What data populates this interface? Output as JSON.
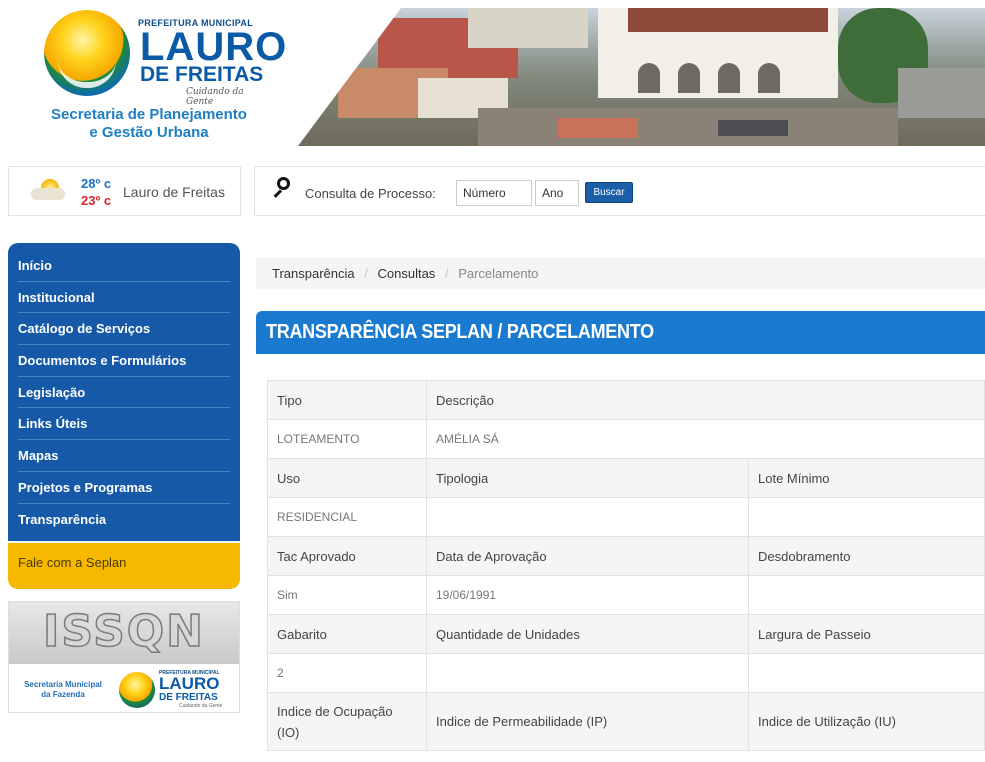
{
  "header": {
    "logo": {
      "prefeitura": "PREFEITURA MUNICIPAL",
      "name_line1": "LAURO",
      "name_line2": "DE FREITAS",
      "tagline": "Cuidando da Gente"
    },
    "secretaria_line1": "Secretaria de Planejamento",
    "secretaria_line2": "e Gestão Urbana"
  },
  "weather": {
    "icon": "sun-cloud-icon",
    "max": "28º c",
    "min": "23º c",
    "city": "Lauro de Freitas"
  },
  "search": {
    "label": "Consulta de Processo:",
    "numero_value": "Número",
    "ano_value": "Ano",
    "button": "Buscar"
  },
  "menu": {
    "items": [
      {
        "label": "Início"
      },
      {
        "label": "Institucional"
      },
      {
        "label": "Catálogo de Serviços"
      },
      {
        "label": "Documentos e Formulários"
      },
      {
        "label": "Legislação"
      },
      {
        "label": "Links Úteis"
      },
      {
        "label": "Mapas"
      },
      {
        "label": "Projetos e Programas"
      },
      {
        "label": "Transparência"
      }
    ],
    "fale": "Fale com a Seplan"
  },
  "issqn": {
    "title": "ISSQN",
    "secretaria": "Secretaria Municipal da Fazenda",
    "logo_small": "PREFEITURA MUNICIPAL",
    "logo_l1": "LAURO",
    "logo_l2": "DE FREITAS",
    "logo_tag": "Cuidando da Gente"
  },
  "breadcrumb": {
    "items": [
      "Transparência",
      "Consultas"
    ],
    "current": "Parcelamento",
    "separator": "/"
  },
  "page": {
    "title": "TRANSPARÊNCIA SEPLAN / PARCELAMENTO"
  },
  "table": {
    "rows": [
      {
        "type": "hdr",
        "cells": [
          "Tipo",
          "Descrição"
        ]
      },
      {
        "type": "val",
        "cells": [
          "LOTEAMENTO",
          "AMÉLIA SÁ"
        ]
      },
      {
        "type": "hdr",
        "cells": [
          "Uso",
          "Tipologia",
          "Lote Mínimo"
        ]
      },
      {
        "type": "val",
        "cells": [
          "RESIDENCIAL",
          "",
          ""
        ]
      },
      {
        "type": "hdr",
        "cells": [
          "Tac Aprovado",
          "Data de Aprovação",
          "Desdobramento"
        ]
      },
      {
        "type": "val",
        "cells": [
          "Sim",
          "19/06/1991",
          ""
        ]
      },
      {
        "type": "hdr",
        "cells": [
          "Gabarito",
          "Quantidade de Unidades",
          "Largura de Passeio"
        ]
      },
      {
        "type": "val",
        "cells": [
          "2",
          "",
          ""
        ]
      },
      {
        "type": "hdr",
        "cells": [
          "Indice de Ocupação (IO)",
          "Indice de Permeabilidade (IP)",
          "Indice de Utilização (IU)"
        ]
      }
    ]
  },
  "colors": {
    "menu_blue": "#1559a8",
    "title_blue": "#1a7acf",
    "fale_yellow": "#f7b800",
    "temp_max": "#1a73c2",
    "temp_min": "#d9262b"
  }
}
